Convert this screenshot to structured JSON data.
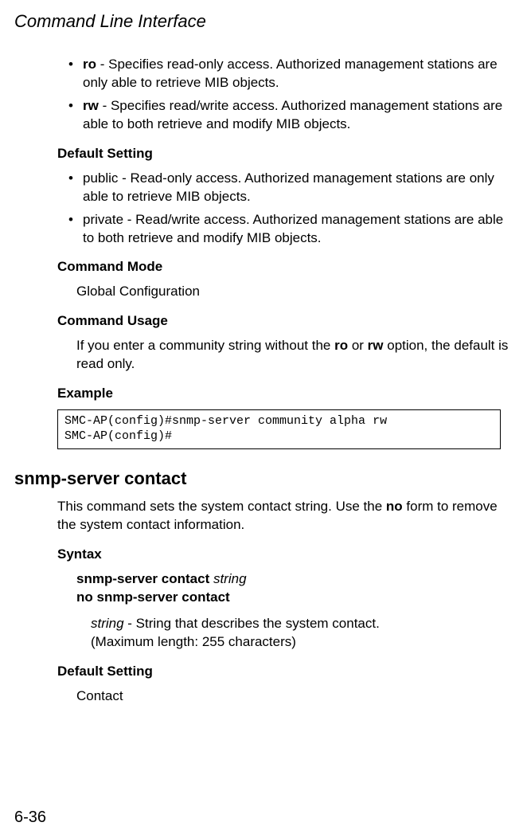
{
  "header": {
    "title": "Command Line Interface"
  },
  "bullets1": [
    {
      "key": "ro",
      "text": " - Specifies read-only access. Authorized management stations are only able to retrieve MIB objects."
    },
    {
      "key": "rw",
      "text": " - Specifies read/write access. Authorized management stations are able to both retrieve and modify MIB objects."
    }
  ],
  "sections": {
    "defaultSetting1": "Default Setting",
    "defaultBullets": [
      "public - Read-only access. Authorized management stations are only able to retrieve MIB objects.",
      "private - Read/write access. Authorized management stations are able to both retrieve and modify MIB objects."
    ],
    "commandMode": "Command Mode",
    "commandModeText": "Global Configuration",
    "commandUsage": "Command Usage",
    "commandUsageText1": "If you enter a community string without the ",
    "commandUsageRo": "ro",
    "commandUsageOr": " or ",
    "commandUsageRw": "rw",
    "commandUsageText2": " option, the default is read only.",
    "example": "Example",
    "exampleCode": "SMC-AP(config)#snmp-server community alpha rw\nSMC-AP(config)#"
  },
  "cmd2": {
    "title": "snmp-server contact",
    "desc1": "This command sets the system contact string. Use the ",
    "descNo": "no",
    "desc2": " form to remove the system contact information.",
    "syntax": "Syntax",
    "syntaxLine1a": "snmp-server contact ",
    "syntaxLine1b": "string",
    "syntaxLine2": "no snmp-server contact",
    "paramKey": "string",
    "paramText1": " - String that describes the system contact.",
    "paramText2": "(Maximum length: 255 characters)",
    "defaultSetting": "Default Setting",
    "defaultText": "Contact"
  },
  "pageNum": "6-36"
}
